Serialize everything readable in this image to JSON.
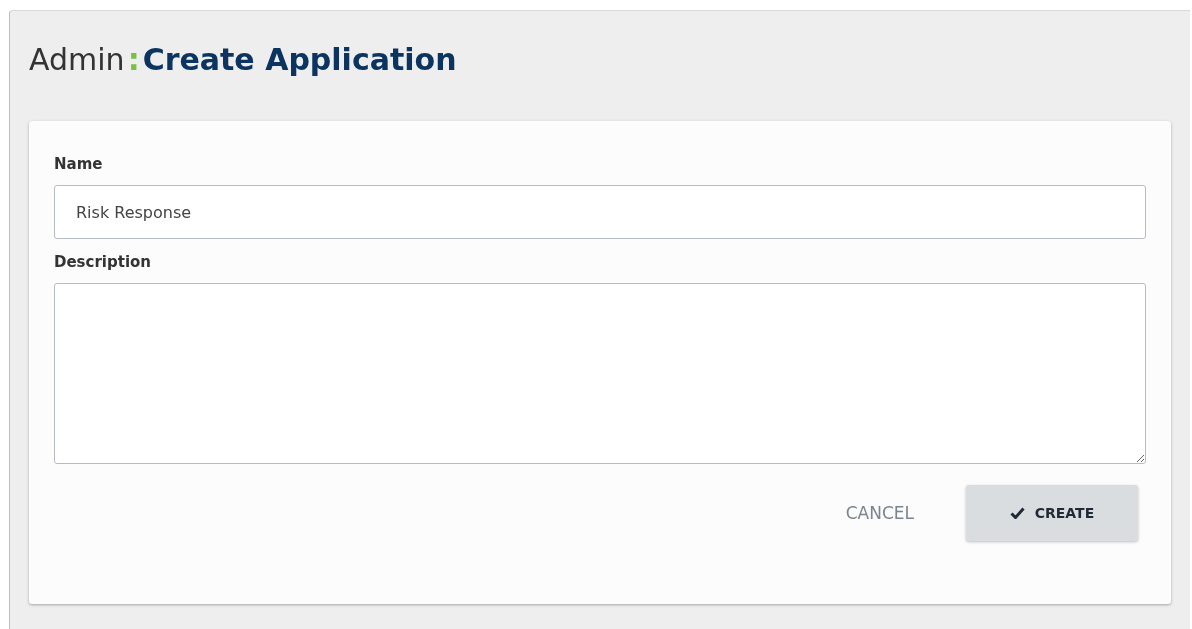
{
  "header": {
    "section": "Admin",
    "separator": ":",
    "title": "Create Application"
  },
  "form": {
    "fields": [
      {
        "kind": "input",
        "label": "Name",
        "value": "Risk Response"
      },
      {
        "kind": "textarea",
        "label": "Description"
      }
    ],
    "buttons": [
      {
        "kind": "text",
        "label": "CANCEL"
      },
      {
        "kind": "primary",
        "label": "CREATE"
      }
    ]
  }
}
